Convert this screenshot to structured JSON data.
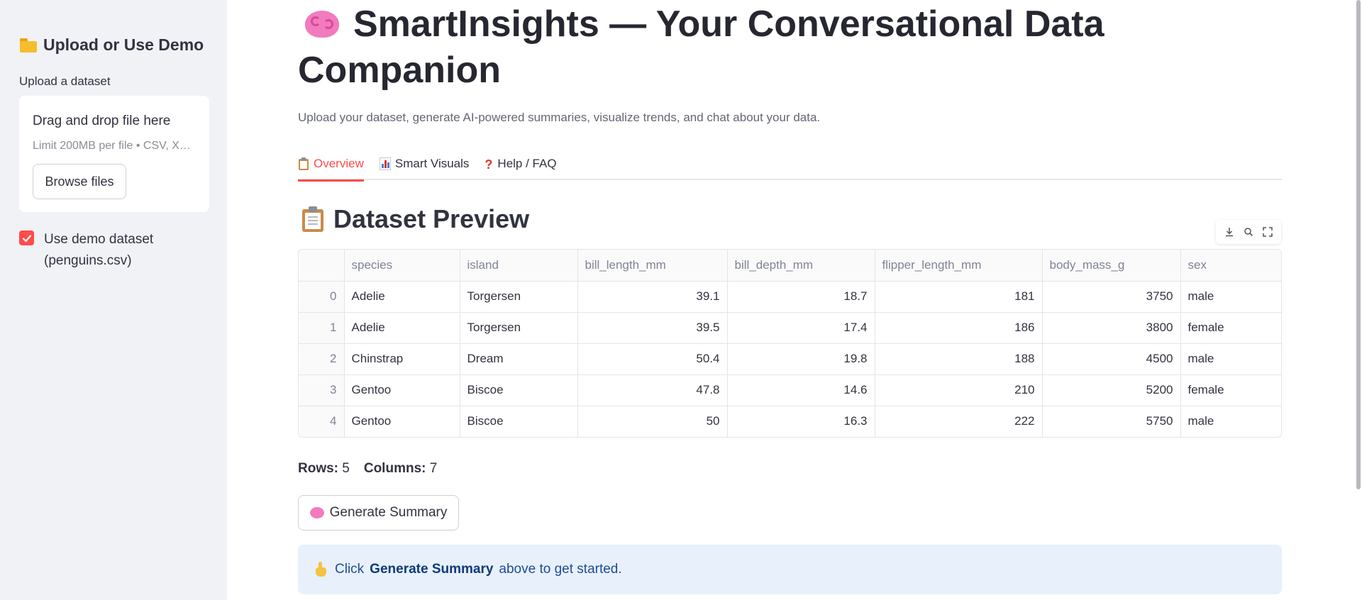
{
  "sidebar": {
    "title": "Upload or Use Demo",
    "upload_label": "Upload a dataset",
    "dropzone_title": "Drag and drop file here",
    "dropzone_limit": "Limit 200MB per file • CSV, X…",
    "browse_label": "Browse files",
    "demo_checked": true,
    "demo_label": "Use demo dataset (penguins.csv)"
  },
  "header": {
    "title": "SmartInsights — Your Conversational Data Companion",
    "subtitle": "Upload your dataset, generate AI-powered summaries, visualize trends, and chat about your data."
  },
  "tabs": [
    {
      "label": "Overview",
      "active": true,
      "icon": "clipboard-icon"
    },
    {
      "label": "Smart Visuals",
      "active": false,
      "icon": "bar-chart-icon"
    },
    {
      "label": "Help / FAQ",
      "active": false,
      "icon": "question-icon"
    }
  ],
  "section": {
    "heading": "Dataset Preview"
  },
  "table": {
    "columns": [
      "",
      "species",
      "island",
      "bill_length_mm",
      "bill_depth_mm",
      "flipper_length_mm",
      "body_mass_g",
      "sex"
    ],
    "rows": [
      [
        "0",
        "Adelie",
        "Torgersen",
        "39.1",
        "18.7",
        "181",
        "3750",
        "male"
      ],
      [
        "1",
        "Adelie",
        "Torgersen",
        "39.5",
        "17.4",
        "186",
        "3800",
        "female"
      ],
      [
        "2",
        "Chinstrap",
        "Dream",
        "50.4",
        "19.8",
        "188",
        "4500",
        "male"
      ],
      [
        "3",
        "Gentoo",
        "Biscoe",
        "47.8",
        "14.6",
        "210",
        "5200",
        "female"
      ],
      [
        "4",
        "Gentoo",
        "Biscoe",
        "50",
        "16.3",
        "222",
        "5750",
        "male"
      ]
    ]
  },
  "stats": {
    "rows_label": "Rows:",
    "rows_value": "5",
    "cols_label": "Columns:",
    "cols_value": "7"
  },
  "generate_label": "Generate Summary",
  "info": {
    "pre": "Click",
    "bold": "Generate Summary",
    "post": "above to get started."
  },
  "colors": {
    "accent": "#ff4b4b",
    "info_bg": "#e8f0fc",
    "sidebar_bg": "#f0f2f6"
  }
}
